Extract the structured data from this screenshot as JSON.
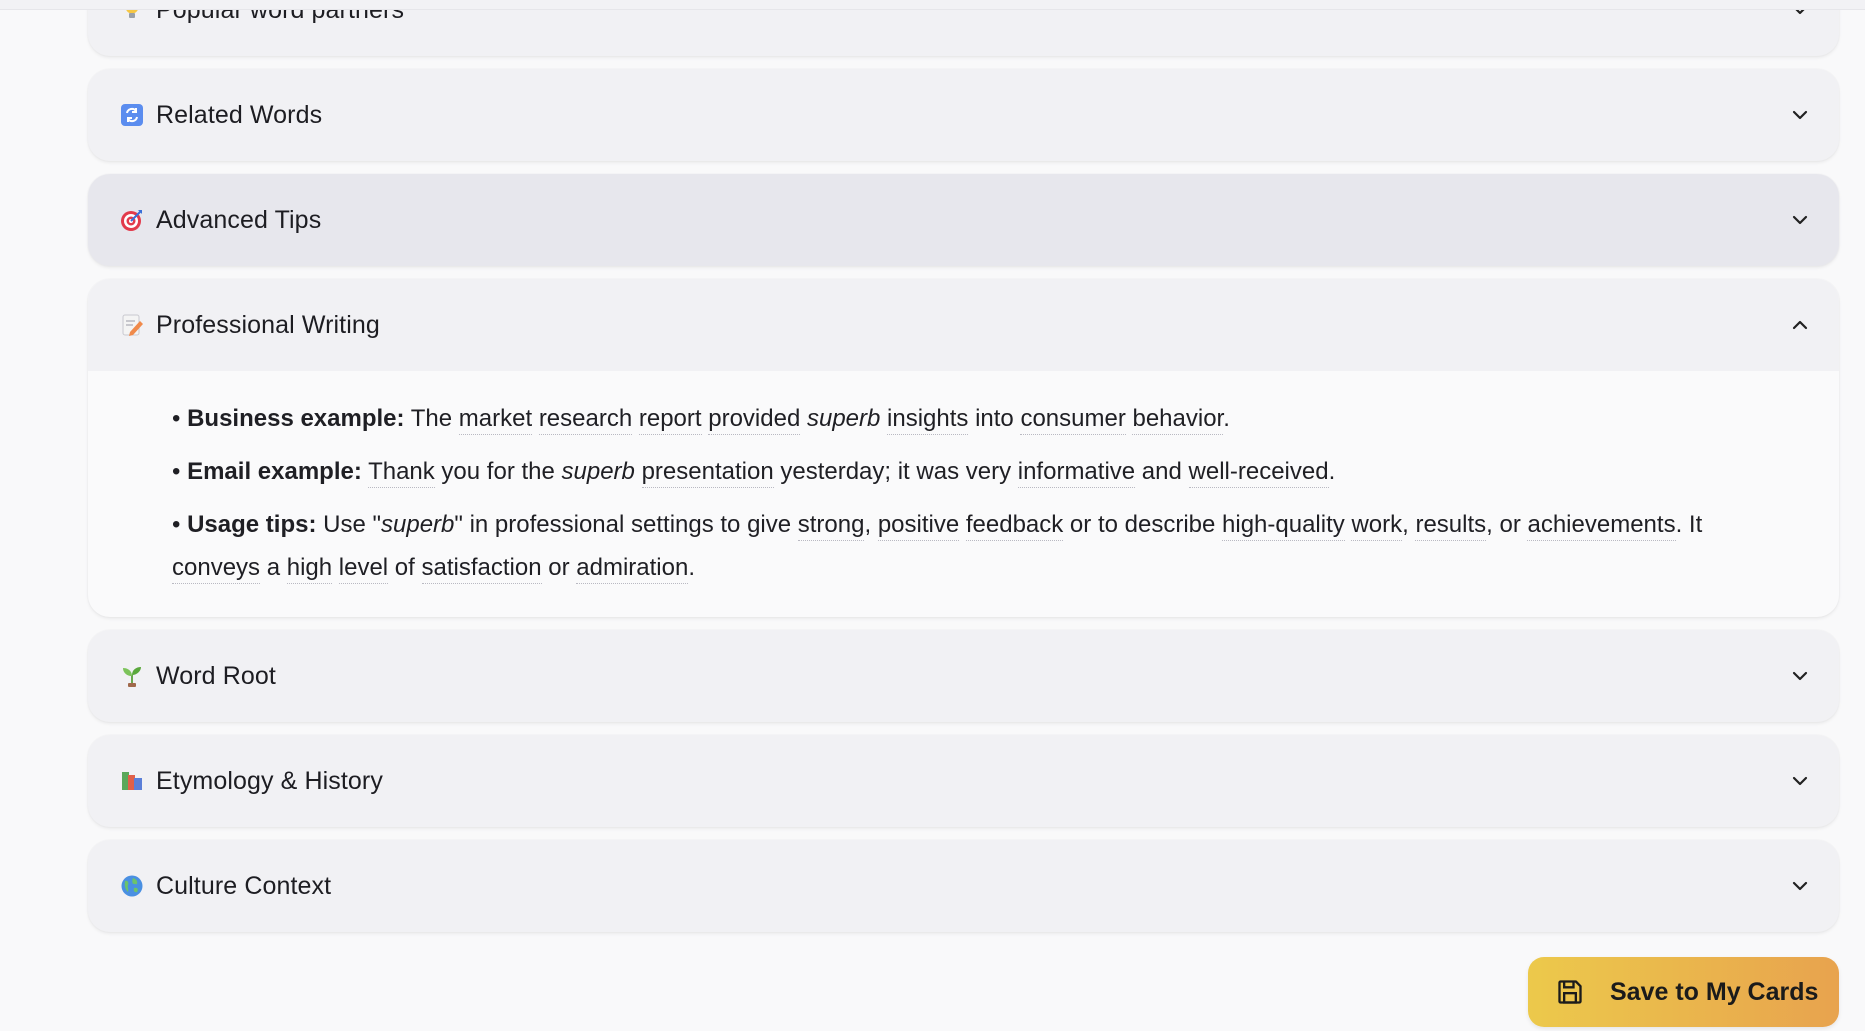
{
  "sections": [
    {
      "title": "Popular word partners",
      "icon": "lightbulb-icon",
      "state": "collapsed"
    },
    {
      "title": "Related Words",
      "icon": "refresh-arrows-icon",
      "state": "collapsed"
    },
    {
      "title": "Advanced Tips",
      "icon": "target-dart-icon",
      "state": "collapsed-hover"
    },
    {
      "title": "Professional Writing",
      "icon": "memo-pencil-icon",
      "state": "expanded"
    },
    {
      "title": "Word Root",
      "icon": "seedling-icon",
      "state": "collapsed"
    },
    {
      "title": "Etymology & History",
      "icon": "books-icon",
      "state": "collapsed"
    },
    {
      "title": "Culture Context",
      "icon": "globe-icon",
      "state": "collapsed"
    }
  ],
  "professional_writing": {
    "business": {
      "label": "Business example:",
      "t1": "The ",
      "w1": "market",
      "t2": " ",
      "w2": "research",
      "t3": " ",
      "w3": "report",
      "t4": " ",
      "w4": "provided",
      "t5": " ",
      "em": "superb",
      "t6": " ",
      "w5": "insights",
      "t7": " into ",
      "w6": "consumer",
      "t8": " ",
      "w7": "behavior",
      "t9": "."
    },
    "email": {
      "label": "Email example:",
      "t1": " ",
      "w1": "Thank",
      "t2": " you for the ",
      "em": "superb",
      "t3": " ",
      "w2": "presentation",
      "t4": " yesterday; it was very ",
      "w3": "informative",
      "t5": " and ",
      "w4": "well-received",
      "t6": "."
    },
    "usage": {
      "label": "Usage tips:",
      "t1": " Use \"",
      "em": "superb",
      "t2": "\" in professional settings to give ",
      "w1": "strong",
      "t3": ", ",
      "w2": "positive",
      "t4": " ",
      "w3": "feedback",
      "t5": " or to describe ",
      "w4": "high-quality",
      "t6": " ",
      "w5": "work",
      "t7": ", ",
      "w6": "results",
      "t8": ", or ",
      "w7": "achievements",
      "t9": ". It ",
      "w8": "conveys",
      "t10": " a ",
      "w9": "high",
      "t11": " ",
      "w10": "level",
      "t12": " of ",
      "w11": "satisfaction",
      "t13": " or ",
      "w12": "admiration",
      "t14": "."
    }
  },
  "save_button": {
    "label": "Save to My Cards",
    "icon": "floppy-disk-icon"
  },
  "colors": {
    "button_gradient_start": "#ecc94b",
    "button_gradient_end": "#e8a34e",
    "card_bg": "#f1f1f4",
    "card_hover_bg": "#e7e7ed"
  }
}
